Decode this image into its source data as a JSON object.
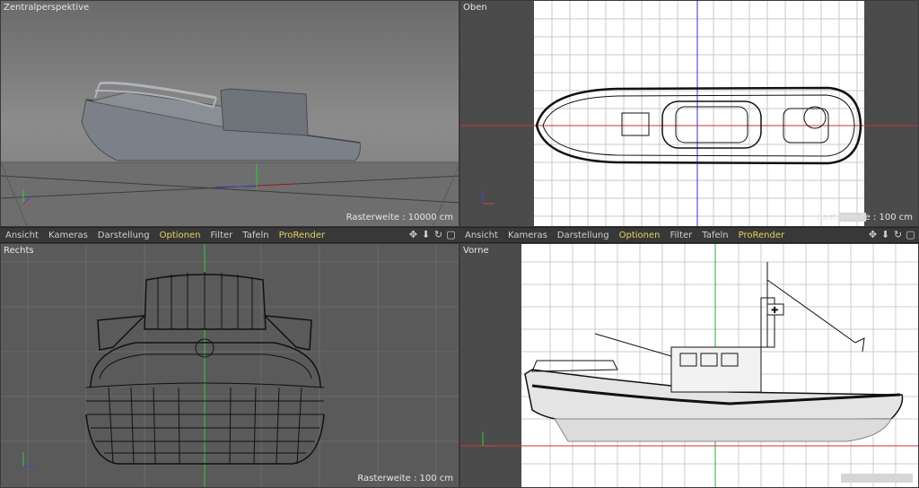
{
  "viewports": {
    "top_left": {
      "title": "Zentralperspektive",
      "grid": "Rasterweite : 10000 cm"
    },
    "top_right": {
      "title": "Oben",
      "grid": "Rasterweite : 100 cm"
    },
    "bottom_left": {
      "title": "Rechts",
      "grid": "Rasterweite : 100 cm"
    },
    "bottom_right": {
      "title": "Vorne"
    }
  },
  "menu": [
    "Ansicht",
    "Kameras",
    "Darstellung",
    "Optionen",
    "Filter",
    "Tafeln",
    "ProRender"
  ],
  "menu_icons": [
    "move-icon",
    "down-arrow-icon",
    "rotate-icon",
    "maximize-icon"
  ],
  "axis_labels": {
    "x": "X",
    "y": "Y",
    "z": "Z"
  },
  "colors": {
    "highlight": "#e8d25a",
    "x_axis": "#d04040",
    "y_axis": "#40c040",
    "z_axis": "#4040d0"
  }
}
